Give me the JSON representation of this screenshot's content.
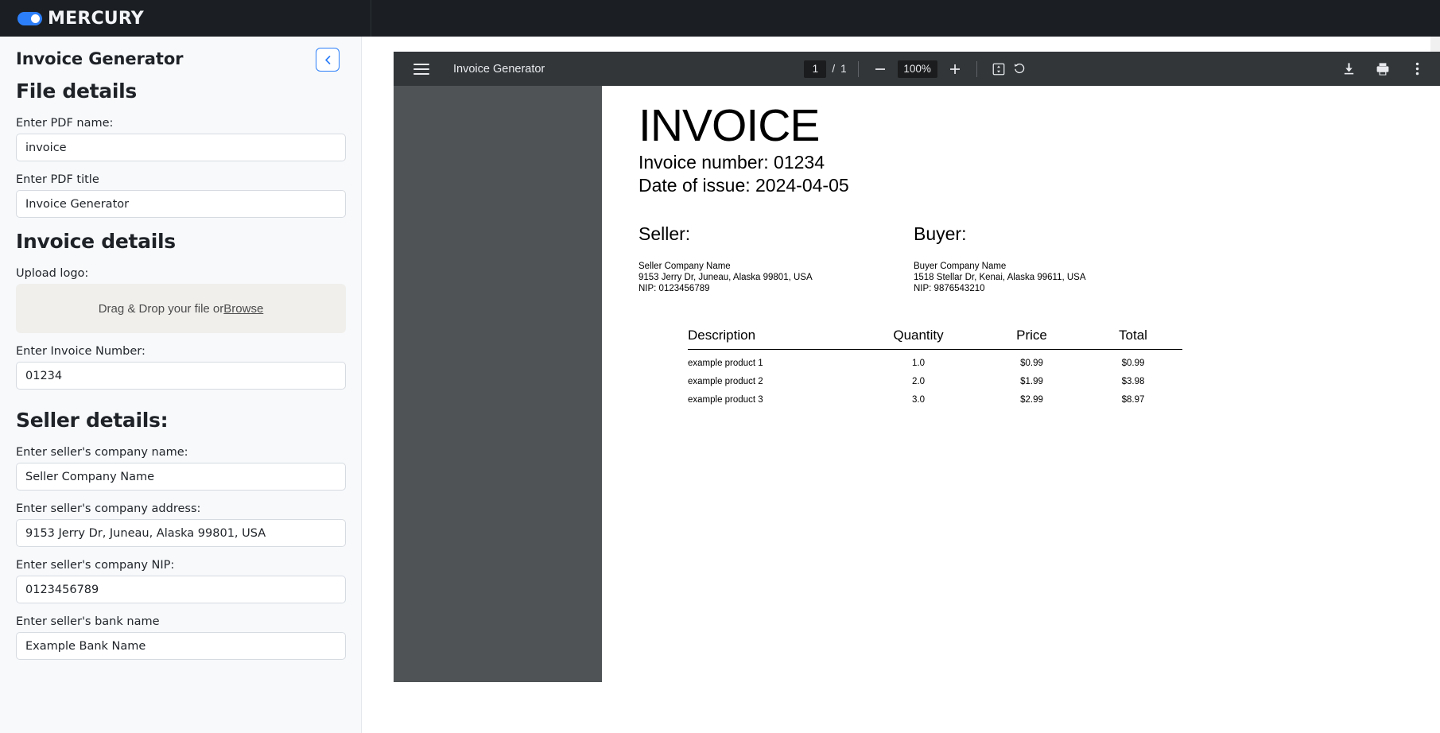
{
  "brand": {
    "name": "MERCURY",
    "accent": "#2d7ff9"
  },
  "sidebar": {
    "app_title": "Invoice Generator",
    "collapse_icon": "chevron-left-icon",
    "sections": {
      "file_details": "File details",
      "invoice_details": "Invoice details",
      "seller_details": "Seller details:"
    },
    "fields": {
      "pdf_name": {
        "label": "Enter PDF name:",
        "value": "invoice"
      },
      "pdf_title": {
        "label": "Enter PDF title",
        "value": "Invoice Generator"
      },
      "upload_logo": {
        "label": "Upload logo:",
        "dropzone_text": "Drag & Drop your file or ",
        "browse_label": "Browse"
      },
      "invoice_number": {
        "label": "Enter Invoice Number:",
        "value": "01234"
      },
      "seller_company_name": {
        "label": "Enter seller's company name:",
        "value": "Seller Company Name"
      },
      "seller_company_address": {
        "label": "Enter seller's company address:",
        "value": "9153 Jerry Dr, Juneau, Alaska 99801, USA"
      },
      "seller_company_nip": {
        "label": "Enter seller's company NIP:",
        "value": "0123456789"
      },
      "seller_bank_name": {
        "label": "Enter seller's bank name",
        "value": "Example Bank Name"
      }
    }
  },
  "pdf_viewer": {
    "menu_icon": "hamburger-menu-icon",
    "document_title": "Invoice Generator",
    "current_page": "1",
    "page_separator": "/",
    "total_pages": "1",
    "zoom_out_icon": "minus-icon",
    "zoom_level": "100%",
    "zoom_in_icon": "plus-icon",
    "fit_page_icon": "fit-to-page-icon",
    "rotate_icon": "rotate-icon",
    "download_icon": "download-icon",
    "print_icon": "print-icon",
    "more_icon": "more-vertical-icon"
  },
  "invoice": {
    "title": "INVOICE",
    "number_line": "Invoice number: 01234",
    "date_line": "Date of issue: 2024-04-05",
    "seller": {
      "heading": "Seller:",
      "company": "Seller Company Name",
      "address": "9153 Jerry Dr, Juneau, Alaska 99801, USA",
      "nip": "NIP: 0123456789"
    },
    "buyer": {
      "heading": "Buyer:",
      "company": "Buyer Company Name",
      "address": "1518 Stellar Dr, Kenai, Alaska 99611, USA",
      "nip": "NIP: 9876543210"
    },
    "table": {
      "columns": [
        "Description",
        "Quantity",
        "Price",
        "Total"
      ],
      "rows": [
        {
          "description": "example product 1",
          "quantity": "1.0",
          "price": "$0.99",
          "total": "$0.99"
        },
        {
          "description": "example product 2",
          "quantity": "2.0",
          "price": "$1.99",
          "total": "$3.98"
        },
        {
          "description": "example product 3",
          "quantity": "3.0",
          "price": "$2.99",
          "total": "$8.97"
        }
      ]
    }
  }
}
